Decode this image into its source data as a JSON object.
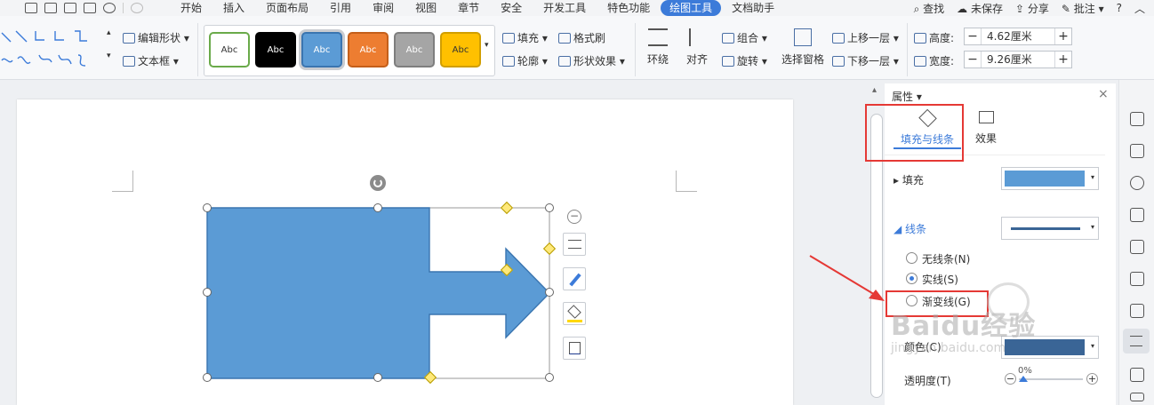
{
  "menubar": {
    "tabs": [
      "开始",
      "插入",
      "页面布局",
      "引用",
      "审阅",
      "视图",
      "章节",
      "安全",
      "开发工具",
      "特色功能",
      "绘图工具",
      "文档助手"
    ],
    "active_tab": "绘图工具",
    "search": "查找",
    "unsaved": "未保存",
    "share": "分享",
    "comment": "批注",
    "help": "?"
  },
  "ribbon": {
    "edit_shape": "编辑形状",
    "text_box": "文本框",
    "style_label": "Abc",
    "styles": [
      {
        "bg": "#ffffff",
        "border": "#6aaa4a",
        "color": "#333333"
      },
      {
        "bg": "#000000",
        "border": "#000000",
        "color": "#ffffff"
      },
      {
        "bg": "#5b9bd5",
        "border": "#3a75b0",
        "color": "#ffffff"
      },
      {
        "bg": "#ed7d31",
        "border": "#c45f1a",
        "color": "#ffffff"
      },
      {
        "bg": "#a5a5a5",
        "border": "#7e7e7e",
        "color": "#ffffff"
      },
      {
        "bg": "#ffc000",
        "border": "#d19e00",
        "color": "#333333"
      }
    ],
    "fill": "填充",
    "format_brush": "格式刷",
    "outline": "轮廓",
    "shape_effect": "形状效果",
    "wrap": "环绕",
    "align": "对齐",
    "group": "组合",
    "rotate": "旋转",
    "selection_pane": "选择窗格",
    "bring_forward": "上移一层",
    "send_backward": "下移一层",
    "height_label": "高度:",
    "height_value": "4.62厘米",
    "width_label": "宽度:",
    "width_value": "9.26厘米"
  },
  "panel": {
    "title": "属性",
    "tab_fill_line": "填充与线条",
    "tab_effect": "效果",
    "fill_label": "填充",
    "line_label": "线条",
    "no_line": "无线条(N)",
    "solid_line": "实线(S)",
    "gradient_line": "渐变线(G)",
    "color_label": "颜色(C)",
    "transparency_label": "透明度(T)",
    "transparency_value": "0%",
    "fill_color": "#5b9bd5",
    "line_color": "#3a6596"
  },
  "shape": {
    "fill": "#5b9bd5",
    "stroke": "#3a75b0"
  },
  "watermark": {
    "brand": "Baidu经验",
    "url": "jingyan.baidu.com"
  }
}
